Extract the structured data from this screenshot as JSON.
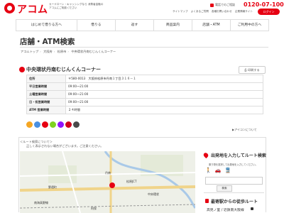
{
  "header": {
    "logo_text": "アコム",
    "tagline": "カードローン・キャッシングなら 消費者金融のアコムにご相談ください",
    "phone_label": "電話でのご相談",
    "phone_number": "0120-07-1000",
    "util_links": [
      "サイトマップ",
      "よくあるご質問",
      "各種お問い合わせ",
      "企業情報サイト"
    ],
    "login_label": "ログイン",
    "brand_color": "#e60012"
  },
  "nav": {
    "items": [
      "はじめて借りる方へ",
      "借りる",
      "返す",
      "商品案内",
      "店舗・ATM",
      "ご利用中の方へ"
    ]
  },
  "page": {
    "title": "店舗・ATM検索",
    "breadcrumb": [
      "アコムトップ",
      "大阪府",
      "松原市",
      "中央環状丹南むじんくんコーナー"
    ]
  },
  "store": {
    "name": "中央環状丹南むじんくんコーナー",
    "print_label": "印刷する",
    "rows": [
      {
        "key": "住所",
        "value": "〒580-0013　大阪府松原市丹南１丁目３１６－１"
      },
      {
        "key": "平日営業時間",
        "value": "09:00～21:00"
      },
      {
        "key": "土曜営業時間",
        "value": "09:00～21:00"
      },
      {
        "key": "日・祝営業時間",
        "value": "09:00～21:00"
      },
      {
        "key": "ATM 営業時間",
        "value": "２４時間"
      }
    ],
    "service_icon_colors": [
      "#f5a623",
      "#4a90e2",
      "#e60012",
      "#7ed321",
      "#9013fe",
      "#d0021b",
      "#4a4a4a"
    ],
    "legend_link": "▶アイコンについて"
  },
  "route": {
    "search_label": "＜ルート検索について＞",
    "note": "正しく表示されない場合がございます。ご注意ください。",
    "panel_title": "出発地を入力してルート検索",
    "panel_sub": "乗り物を選択して出発地を入力してください。",
    "transport_icons": [
      "walk-icon",
      "car-icon",
      "train-icon"
    ],
    "input_placeholder": "",
    "search_label_btn": "検索",
    "nearest_title": "最寄駅からの徒歩ルート",
    "nearest_station": "高見ノ里 / 近鉄南大阪線"
  },
  "map": {
    "labels": [
      "丹南",
      "松原JCT",
      "野遠町",
      "阿保",
      "南海高野線",
      "中央環状"
    ]
  }
}
